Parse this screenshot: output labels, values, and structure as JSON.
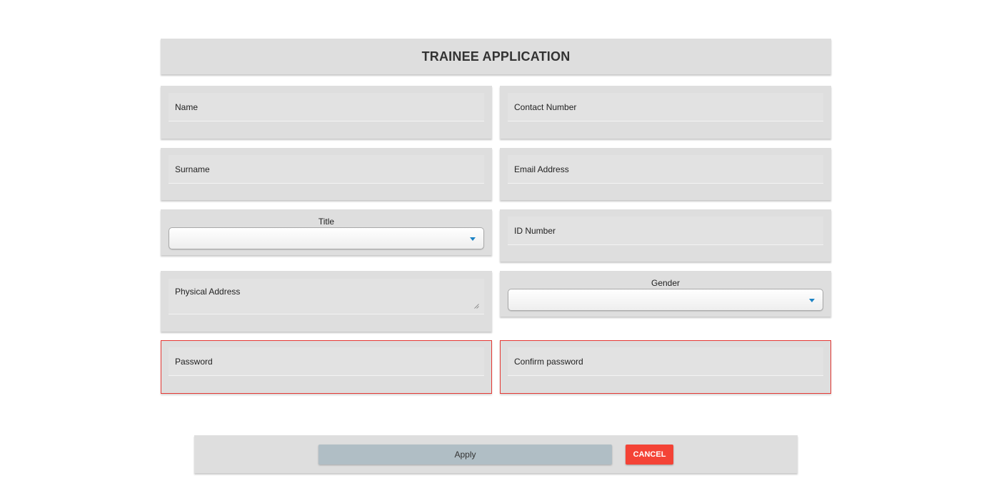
{
  "header": {
    "title": "TRAINEE APPLICATION"
  },
  "form": {
    "name": {
      "placeholder": "Name",
      "value": ""
    },
    "contact_number": {
      "placeholder": "Contact Number",
      "value": ""
    },
    "surname": {
      "placeholder": "Surname",
      "value": ""
    },
    "email_address": {
      "placeholder": "Email Address",
      "value": ""
    },
    "title": {
      "label": "Title",
      "selected": ""
    },
    "id_number": {
      "placeholder": "ID Number",
      "value": ""
    },
    "physical_address": {
      "placeholder": "Physical Address",
      "value": ""
    },
    "gender": {
      "label": "Gender",
      "selected": ""
    },
    "password": {
      "placeholder": "Password",
      "value": ""
    },
    "confirm_password": {
      "placeholder": "Confirm password",
      "value": ""
    }
  },
  "actions": {
    "apply_label": "Apply",
    "cancel_label": "CANCEL"
  },
  "colors": {
    "card_background": "#dedede",
    "error_border": "#e53935",
    "apply_button": "#b0bec5",
    "cancel_button": "#f44336",
    "select_caret": "#1a82c4"
  },
  "icons": {
    "select_caret": "caret-down-icon",
    "textarea_resize": "resize-grip-icon"
  }
}
